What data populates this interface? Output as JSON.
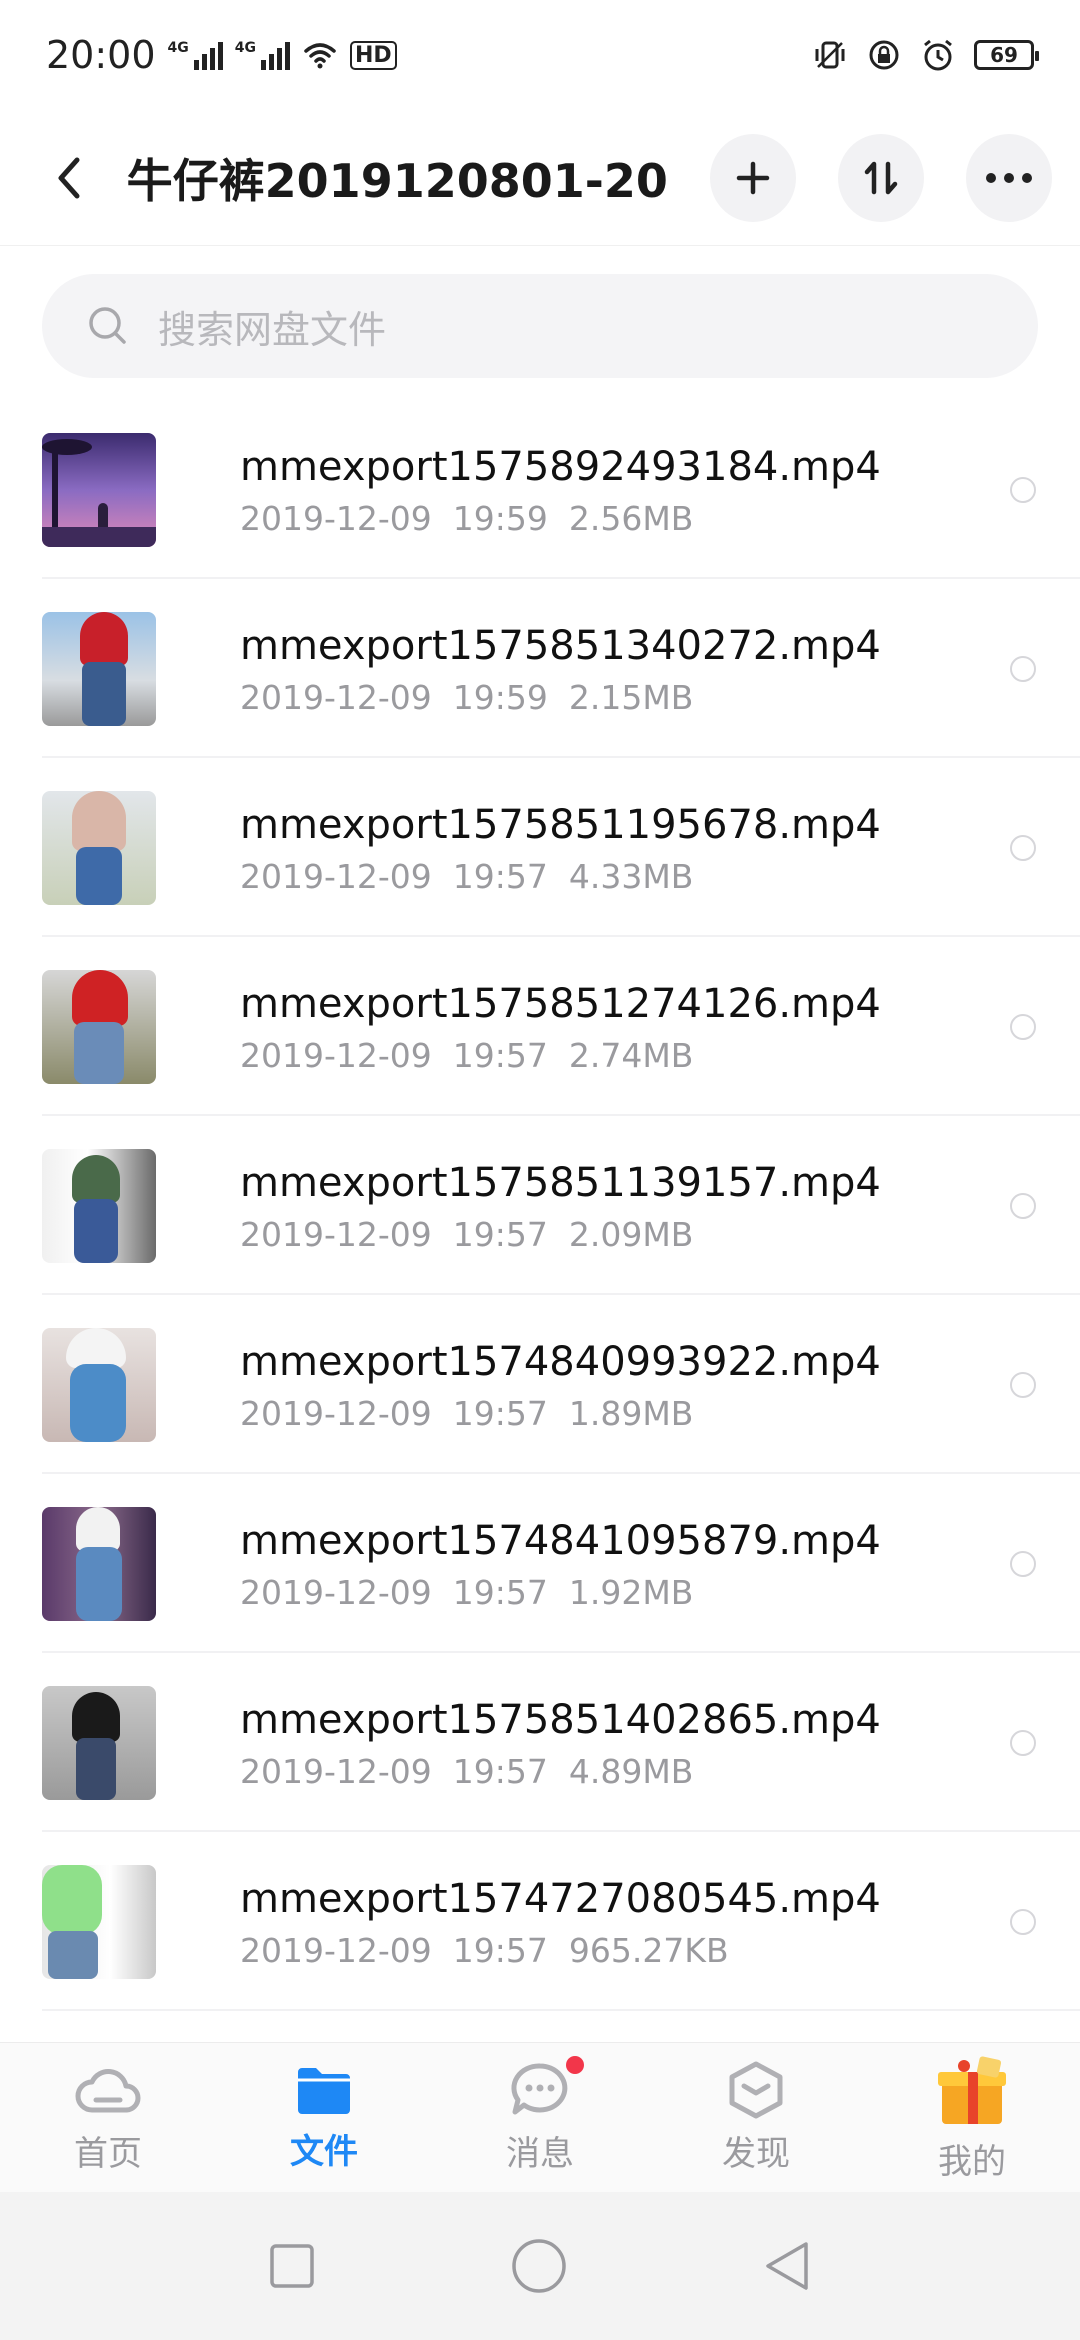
{
  "status_bar": {
    "time": "20:00",
    "network_1": "4G",
    "network_2": "4G",
    "hd_label": "HD",
    "battery": "69"
  },
  "header": {
    "title": "牛仔裤2019120801-20"
  },
  "search": {
    "placeholder": "搜索网盘文件"
  },
  "files": [
    {
      "name": "mmexport1575892493184.mp4",
      "meta": "2019-12-09  19:59  2.56MB"
    },
    {
      "name": "mmexport1575851340272.mp4",
      "meta": "2019-12-09  19:59  2.15MB"
    },
    {
      "name": "mmexport1575851195678.mp4",
      "meta": "2019-12-09  19:57  4.33MB"
    },
    {
      "name": "mmexport1575851274126.mp4",
      "meta": "2019-12-09  19:57  2.74MB"
    },
    {
      "name": "mmexport1575851139157.mp4",
      "meta": "2019-12-09  19:57  2.09MB"
    },
    {
      "name": "mmexport1574840993922.mp4",
      "meta": "2019-12-09  19:57  1.89MB"
    },
    {
      "name": "mmexport1574841095879.mp4",
      "meta": "2019-12-09  19:57  1.92MB"
    },
    {
      "name": "mmexport1575851402865.mp4",
      "meta": "2019-12-09  19:57  4.89MB"
    },
    {
      "name": "mmexport1574727080545.mp4",
      "meta": "2019-12-09  19:57  965.27KB"
    }
  ],
  "bottom_nav": {
    "items": [
      {
        "label": "首页",
        "icon": "cloud-icon"
      },
      {
        "label": "文件",
        "icon": "folder-icon"
      },
      {
        "label": "消息",
        "icon": "chat-icon"
      },
      {
        "label": "发现",
        "icon": "discover-icon"
      },
      {
        "label": "我的",
        "icon": "gift-icon"
      }
    ],
    "active_index": 1,
    "active_color": "#1e88f5"
  },
  "colors": {
    "accent": "#1e88f5",
    "badge": "#f2364a"
  }
}
